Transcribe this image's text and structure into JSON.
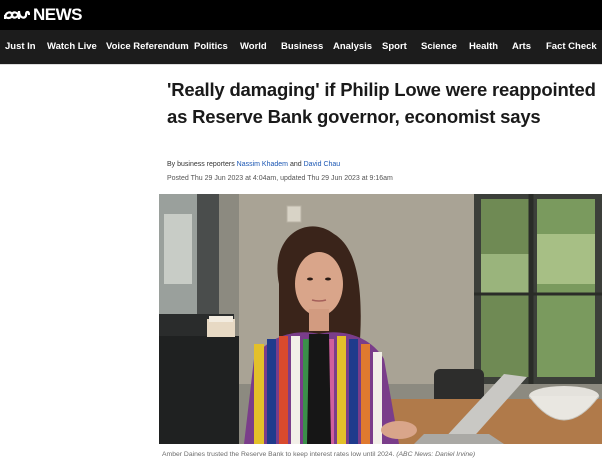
{
  "brand": {
    "logo_text": "NEWS"
  },
  "nav": {
    "items": [
      {
        "label": "Just In"
      },
      {
        "label": "Watch Live"
      },
      {
        "label": "Voice Referendum"
      },
      {
        "label": "Politics"
      },
      {
        "label": "World"
      },
      {
        "label": "Business"
      },
      {
        "label": "Analysis"
      },
      {
        "label": "Sport"
      },
      {
        "label": "Science"
      },
      {
        "label": "Health"
      },
      {
        "label": "Arts"
      },
      {
        "label": "Fact Check"
      }
    ]
  },
  "article": {
    "headline": "'Really damaging' if Philip Lowe were reappointed as Reserve Bank governor, economist says",
    "byline_prefix": "By business reporters",
    "author_1": "Nassim Khadem",
    "byline_and": "and",
    "author_2": "David Chau",
    "posted": "Posted Thu 29 Jun 2023 at 4:04am, updated Thu 29 Jun 2023 at 9:16am",
    "caption": "Amber Daines trusted the Reserve Bank to keep interest rates low until 2024.",
    "caption_credit": "(ABC News: Daniel Irvine)"
  },
  "colors": {
    "top_bar": "#000000",
    "nav_bar": "#1c1c1c",
    "link": "#1a56b3"
  }
}
